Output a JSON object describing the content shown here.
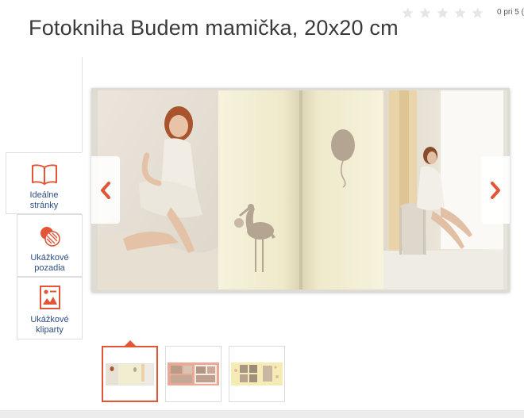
{
  "product": {
    "title": "Fotokniha Budem mamička, 20x20 cm",
    "rating_text": "0 pri 5 (",
    "stars_filled": 0,
    "stars_total": 5
  },
  "tools": [
    {
      "label_line1": "Ideálne",
      "label_line2": "stránky",
      "icon": "book-icon"
    },
    {
      "label_line1": "Ukážkové",
      "label_line2": "pozadia",
      "icon": "background-icon"
    },
    {
      "label_line1": "Ukážkové",
      "label_line2": "kliparty",
      "icon": "clipart-icon"
    }
  ],
  "preview": {
    "prev_icon": "chevron-left-icon",
    "next_icon": "chevron-right-icon"
  },
  "thumbnails": {
    "count": 3,
    "active_index": 0
  },
  "colors": {
    "accent": "#e25536",
    "link": "#2d4f85",
    "page_cream": "#f3efd0"
  }
}
